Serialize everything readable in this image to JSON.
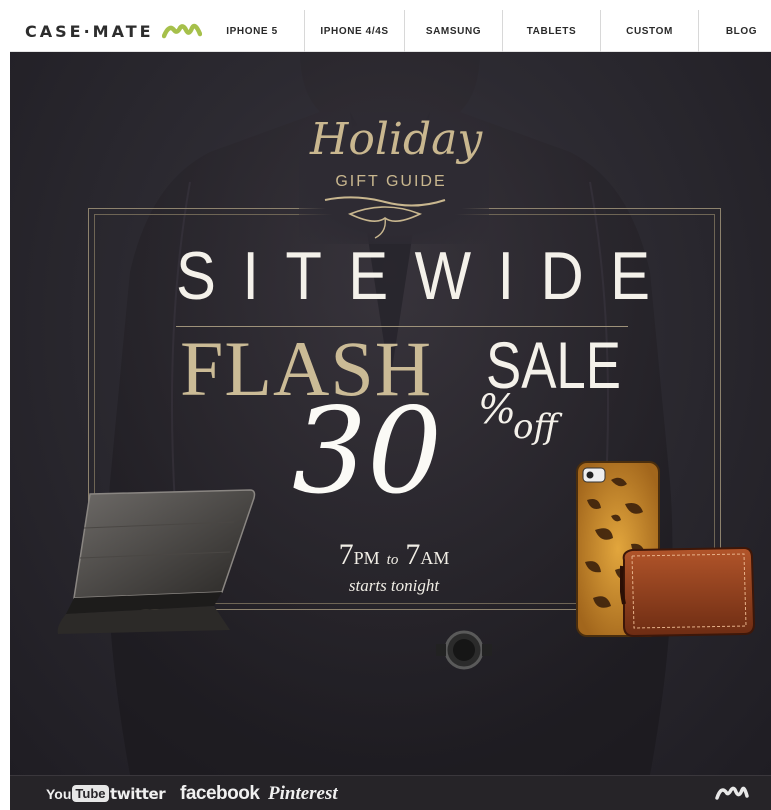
{
  "brand": {
    "name": "CASE·MATE",
    "logo_icon": "case-mate-mark-icon",
    "accent": "#a6c04b"
  },
  "nav": {
    "items": [
      {
        "label": "IPHONE 5"
      },
      {
        "label": "IPHONE 4/4S"
      },
      {
        "label": "SAMSUNG"
      },
      {
        "label": "TABLETS"
      },
      {
        "label": "CUSTOM"
      },
      {
        "label": "BLOG"
      }
    ]
  },
  "hero": {
    "holiday": "Holiday",
    "gift_guide": "GIFT GUIDE",
    "sitewide": "SITEWIDE",
    "flash": "FLASH",
    "sale": "SALE",
    "discount": "30",
    "percent": "%",
    "off": "off",
    "time_start_big": "7",
    "time_start_small": "PM",
    "time_to": "to",
    "time_end_big": "7",
    "time_end_small": "AM",
    "starts": "starts tonight",
    "colors": {
      "gold": "#c9b78f",
      "cream": "#f4f1ea",
      "background": "#2c2a31"
    }
  },
  "footer": {
    "youtube_you": "You",
    "youtube_tube": "Tube",
    "twitter": "twitter",
    "facebook": "facebook",
    "pinterest": "Pinterest",
    "logo_icon": "case-mate-mark-icon"
  }
}
